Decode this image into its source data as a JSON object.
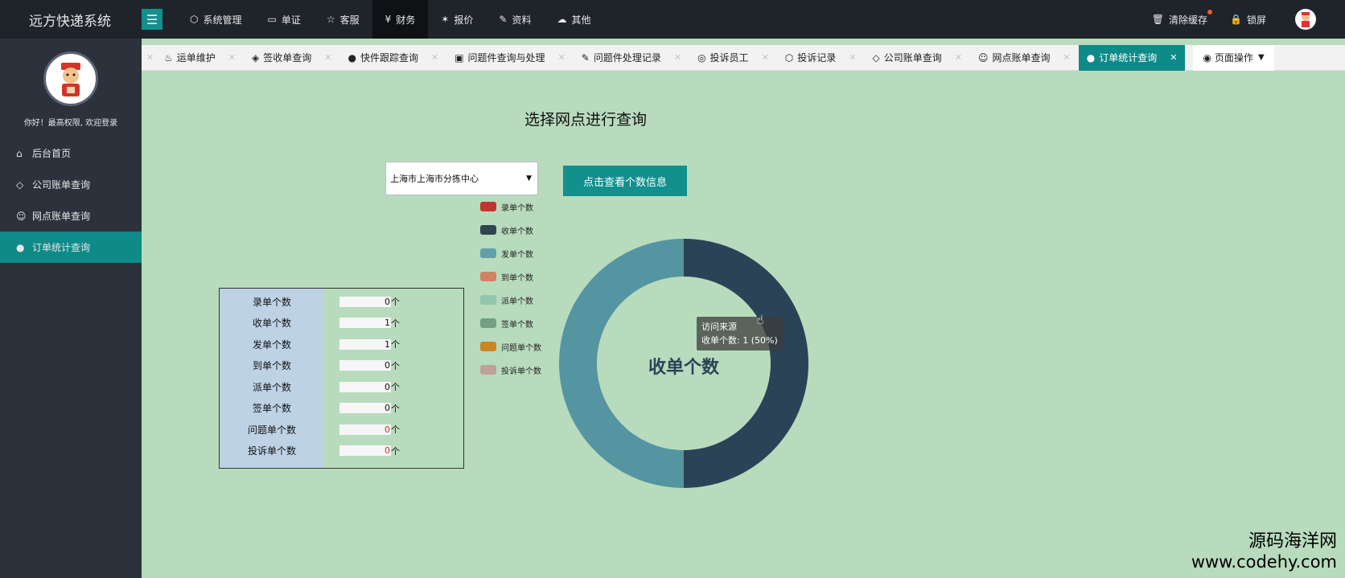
{
  "app": {
    "title": "远方快递系统"
  },
  "topnav": [
    {
      "icon": "cube-icon",
      "glyph": "⬡",
      "label": "系统管理"
    },
    {
      "icon": "book-icon",
      "glyph": "▭",
      "label": "单证"
    },
    {
      "icon": "star-icon",
      "glyph": "☆",
      "label": "客服"
    },
    {
      "icon": "yen-icon",
      "glyph": "¥",
      "label": "财务",
      "active": true
    },
    {
      "icon": "pin-icon",
      "glyph": "✶",
      "label": "报价"
    },
    {
      "icon": "edit-icon",
      "glyph": "✎",
      "label": "资料"
    },
    {
      "icon": "cloud-icon",
      "glyph": "☁",
      "label": "其他"
    }
  ],
  "topright": {
    "clear_cache": "清除缓存",
    "lock": "锁屏"
  },
  "sidebar": {
    "greeting": "你好！最高权限, 欢迎登录",
    "items": [
      {
        "icon": "home-icon",
        "glyph": "⌂",
        "label": "后台首页"
      },
      {
        "icon": "diamond-icon",
        "glyph": "◇",
        "label": "公司账单查询"
      },
      {
        "icon": "smile-icon",
        "glyph": "☺",
        "label": "网点账单查询"
      },
      {
        "icon": "circle-icon",
        "glyph": "●",
        "label": "订单统计查询",
        "active": true
      }
    ]
  },
  "tabs": [
    {
      "icon": "fire-icon",
      "glyph": "♨",
      "label": "运单维护"
    },
    {
      "icon": "diamond-icon",
      "glyph": "◈",
      "label": "签收单查询"
    },
    {
      "icon": "github-icon",
      "glyph": "●",
      "label": "快件跟踪查询"
    },
    {
      "icon": "qrcode-icon",
      "glyph": "▣",
      "label": "问题件查询与处理"
    },
    {
      "icon": "edit-icon",
      "glyph": "✎",
      "label": "问题件处理记录"
    },
    {
      "icon": "gauge-icon",
      "glyph": "◎",
      "label": "投诉员工"
    },
    {
      "icon": "cube-icon",
      "glyph": "⬡",
      "label": "投诉记录"
    },
    {
      "icon": "diamond-icon",
      "glyph": "◇",
      "label": "公司账单查询"
    },
    {
      "icon": "smile-icon",
      "glyph": "☺",
      "label": "网点账单查询"
    },
    {
      "icon": "circle-icon",
      "glyph": "●",
      "label": "订单统计查询",
      "active": true
    }
  ],
  "page_ops": {
    "label": "页面操作"
  },
  "main": {
    "title": "选择网点进行查询",
    "select_value": "上海市上海市分拣中心",
    "query_button": "点击查看个数信息"
  },
  "stats": [
    {
      "label": "录单个数",
      "value": "0",
      "unit": "个"
    },
    {
      "label": "收单个数",
      "value": "1",
      "unit": "个"
    },
    {
      "label": "发单个数",
      "value": "1",
      "unit": "个"
    },
    {
      "label": "到单个数",
      "value": "0",
      "unit": "个"
    },
    {
      "label": "派单个数",
      "value": "0",
      "unit": "个"
    },
    {
      "label": "签单个数",
      "value": "0",
      "unit": "个"
    },
    {
      "label": "问题单个数",
      "value": "0",
      "unit": "个",
      "red": true
    },
    {
      "label": "投诉单个数",
      "value": "0",
      "unit": "个",
      "red": true
    }
  ],
  "colors": {
    "accent": "#0e8a88",
    "series": [
      "#c23531",
      "#2f4554",
      "#61a0a8",
      "#d48265",
      "#91c7ae",
      "#749f83",
      "#ca8622",
      "#bda29a"
    ]
  },
  "chart_data": {
    "type": "pie",
    "center_label": "收单个数",
    "categories": [
      "录单个数",
      "收单个数",
      "发单个数",
      "到单个数",
      "派单个数",
      "签单个数",
      "问题单个数",
      "投诉单个数"
    ],
    "values": [
      0,
      1,
      1,
      0,
      0,
      0,
      0,
      0
    ],
    "slice_colors": [
      "#c23531",
      "#2b4356",
      "#5595a2",
      "#d48265",
      "#91c7ae",
      "#749f83",
      "#ca8622",
      "#bda29a"
    ],
    "legend_position": "left",
    "tooltip": {
      "title": "访问来源",
      "text": "收单个数: 1 (50%)"
    }
  },
  "watermark": {
    "line1": "源码海洋网",
    "line2": "www.codehy.com"
  }
}
